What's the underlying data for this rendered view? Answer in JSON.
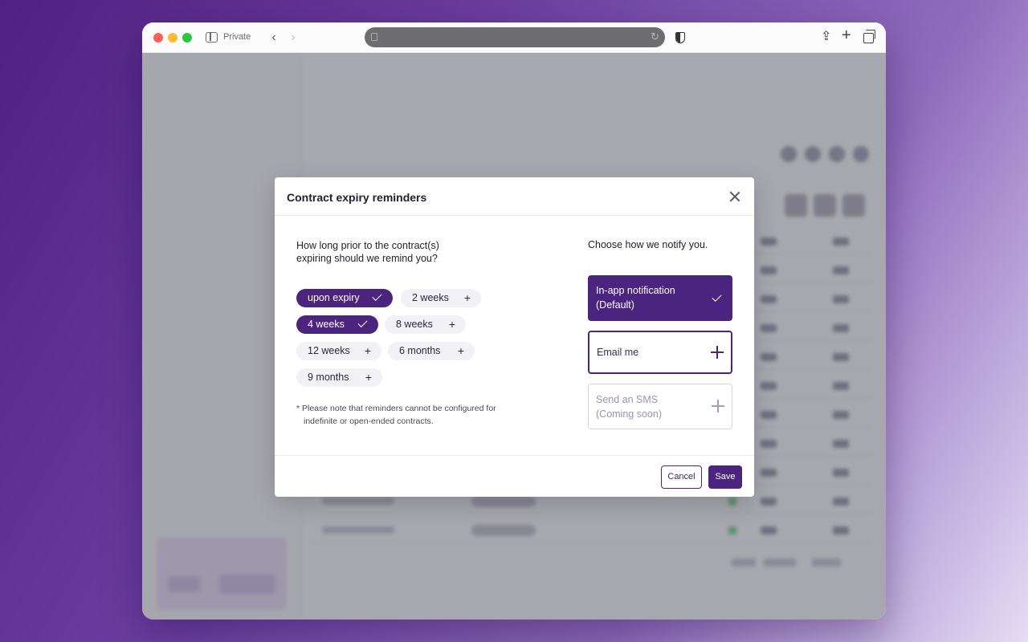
{
  "browser": {
    "private_label": "Private",
    "back_glyph": "‹",
    "forward_glyph": "›",
    "icons": [
      "sidebar-icon",
      "back-icon",
      "forward-icon",
      "page-icon",
      "reload-icon",
      "shield-icon",
      "share-icon",
      "new-tab-icon",
      "tabs-icon"
    ]
  },
  "modal": {
    "title": "Contract expiry reminders",
    "question": "How long prior to the contract(s) expiring should we remind you?",
    "intervals": [
      {
        "label": "upon expiry",
        "selected": true
      },
      {
        "label": "2 weeks",
        "selected": false
      },
      {
        "label": "4 weeks",
        "selected": true
      },
      {
        "label": "8 weeks",
        "selected": false
      },
      {
        "label": "12 weeks",
        "selected": false
      },
      {
        "label": "6 months",
        "selected": false
      },
      {
        "label": "9 months",
        "selected": false
      }
    ],
    "note_line1": "* Please note that reminders cannot be configured for",
    "note_line2": "indefinite or open-ended contracts.",
    "notify_title": "Choose how we notify you.",
    "options": {
      "inapp_line1": "In-app notification",
      "inapp_line2": "(Default)",
      "email": "Email me",
      "sms_line1": "Send an SMS",
      "sms_line2": "(Coming soon)"
    },
    "cancel_label": "Cancel",
    "save_label": "Save"
  },
  "colors": {
    "accent": "#4b2480",
    "background_gradient_start": "#4f2184",
    "background_gradient_end": "#e6dcf3"
  }
}
